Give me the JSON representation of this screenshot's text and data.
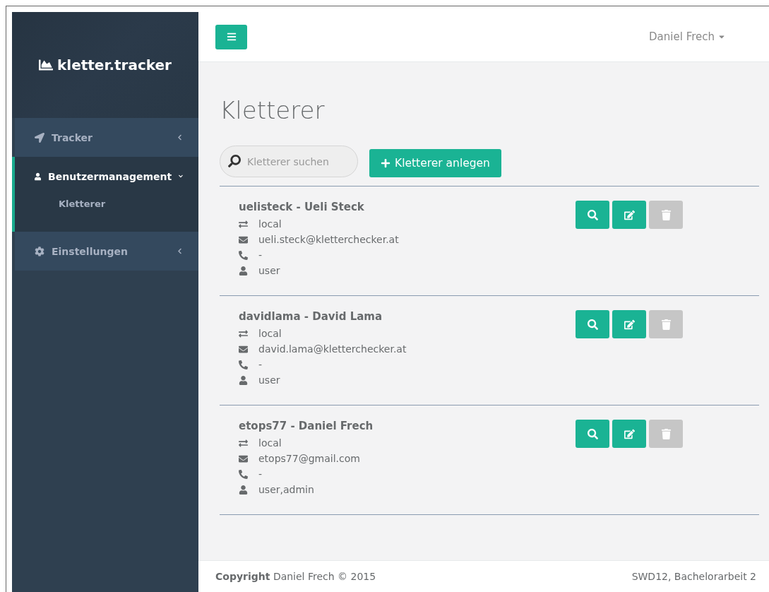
{
  "sidebar": {
    "logo": "kletter.tracker",
    "items": [
      {
        "label": "Tracker",
        "kind": "collapsed",
        "selected": false,
        "expanded": false
      },
      {
        "label": "Benutzermanagement",
        "kind": "user",
        "selected": true,
        "expanded": true,
        "children": [
          {
            "label": "Kletterer",
            "selected": true
          }
        ]
      },
      {
        "label": "Einstellungen",
        "kind": "settings",
        "selected": false,
        "expanded": false
      }
    ]
  },
  "topbar": {
    "user": "Daniel Frech"
  },
  "page": {
    "title": "Kletterer",
    "search": {
      "placeholder": "Kletterer suchen"
    },
    "add_button": "Kletterer anlegen"
  },
  "users": [
    {
      "name": "uelisteck - Ueli Steck",
      "provider": "local",
      "email": "ueli.steck@kletterchecker.at",
      "phone": "-",
      "roles": "user",
      "delete_disabled": true
    },
    {
      "name": "davidlama - David Lama",
      "provider": "local",
      "email": "david.lama@kletterchecker.at",
      "phone": "-",
      "roles": "user",
      "delete_disabled": true
    },
    {
      "name": "etops77 - Daniel Frech",
      "provider": "local",
      "email": "etops77@gmail.com",
      "phone": "-",
      "roles": "user,admin",
      "delete_disabled": true
    }
  ],
  "footer": {
    "left": "**Copyright** Daniel Frech © 2015",
    "right": "SWD12, Bachelorarbeit 2"
  }
}
